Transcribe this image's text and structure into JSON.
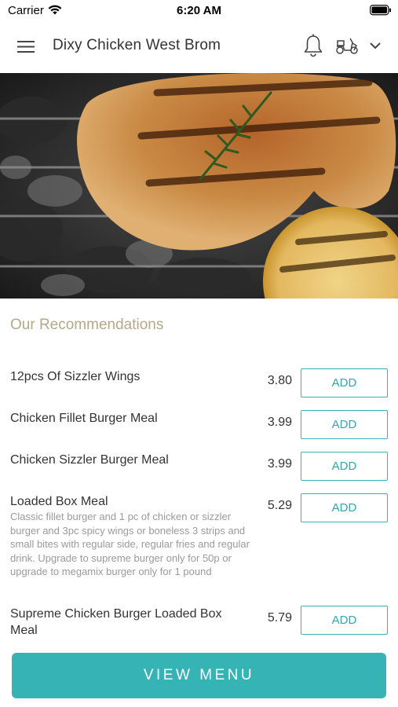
{
  "status_bar": {
    "carrier": "Carrier",
    "time": "6:20 AM"
  },
  "header": {
    "menu_icon": "hamburger-menu-icon",
    "title": "Dixy Chicken West Brom",
    "bell_icon": "bell-icon",
    "delivery_icon": "scooter-icon",
    "dropdown_icon": "chevron-down-icon"
  },
  "hero": {
    "alt": "grilled chicken with rosemary and grilled lemon"
  },
  "recommendations": {
    "title": "Our Recommendations",
    "items": [
      {
        "name": "12pcs Of Sizzler Wings",
        "description": "",
        "price": "3.80",
        "button": "ADD"
      },
      {
        "name": "Chicken Fillet Burger Meal",
        "description": "",
        "price": "3.99",
        "button": "ADD"
      },
      {
        "name": "Chicken Sizzler Burger Meal",
        "description": "",
        "price": "3.99",
        "button": "ADD"
      },
      {
        "name": "Loaded Box Meal",
        "description": "Classic fillet burger and 1 pc of chicken or sizzler burger and 3pc spicy wings or boneless 3 strips and small bites with regular side, regular fries and regular drink. Upgrade to supreme burger only for 50p or upgrade to megamix burger only for 1 pound",
        "price": "5.29",
        "button": "ADD"
      },
      {
        "name": "Supreme Chicken Burger Loaded Box Meal",
        "description": "",
        "price": "5.79",
        "button": "ADD"
      }
    ]
  },
  "view_menu_button": "VIEW MENU",
  "colors": {
    "accent": "#35b3b5",
    "section_title": "#b5a88a"
  }
}
